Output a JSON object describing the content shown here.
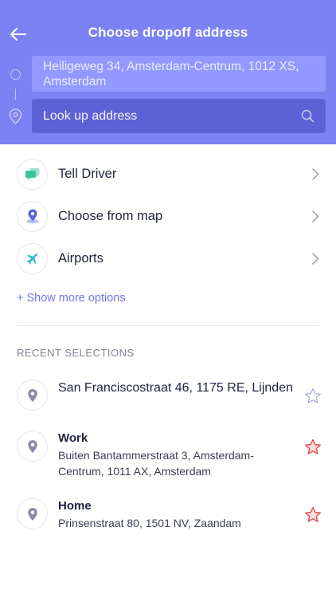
{
  "header": {
    "title": "Choose dropoff address",
    "pickup_address": "Heiligeweg 34, Amsterdam-Centrum, 1012 XS, Amsterdam",
    "dropoff_placeholder": "Look up address",
    "dropoff_value": ""
  },
  "options": [
    {
      "label": "Tell Driver",
      "icon": "chat-bubbles-icon",
      "color": "#3cc29b"
    },
    {
      "label": "Choose from map",
      "icon": "map-pin-icon",
      "color": "#5a62d6"
    },
    {
      "label": "Airports",
      "icon": "airplane-icon",
      "color": "#2bb5d6"
    }
  ],
  "show_more": "+ Show more options",
  "recent": {
    "title": "RECENT SELECTIONS",
    "items": [
      {
        "name": "",
        "address": "San Franciscostraat 46, 1175 RE, Lijnden",
        "favorite": false
      },
      {
        "name": "Work",
        "address": "Buiten Bantammerstraat 3, Amsterdam-Centrum, 1011 AX, Amsterdam",
        "favorite": true
      },
      {
        "name": "Home",
        "address": "Prinsenstraat 80, 1501 NV, Zaandam",
        "favorite": true
      }
    ]
  },
  "colors": {
    "header_bg": "#7b82f3",
    "accent": "#6f76e8",
    "favorite_star": "#e24b4b",
    "empty_star": "#a9acd9"
  }
}
